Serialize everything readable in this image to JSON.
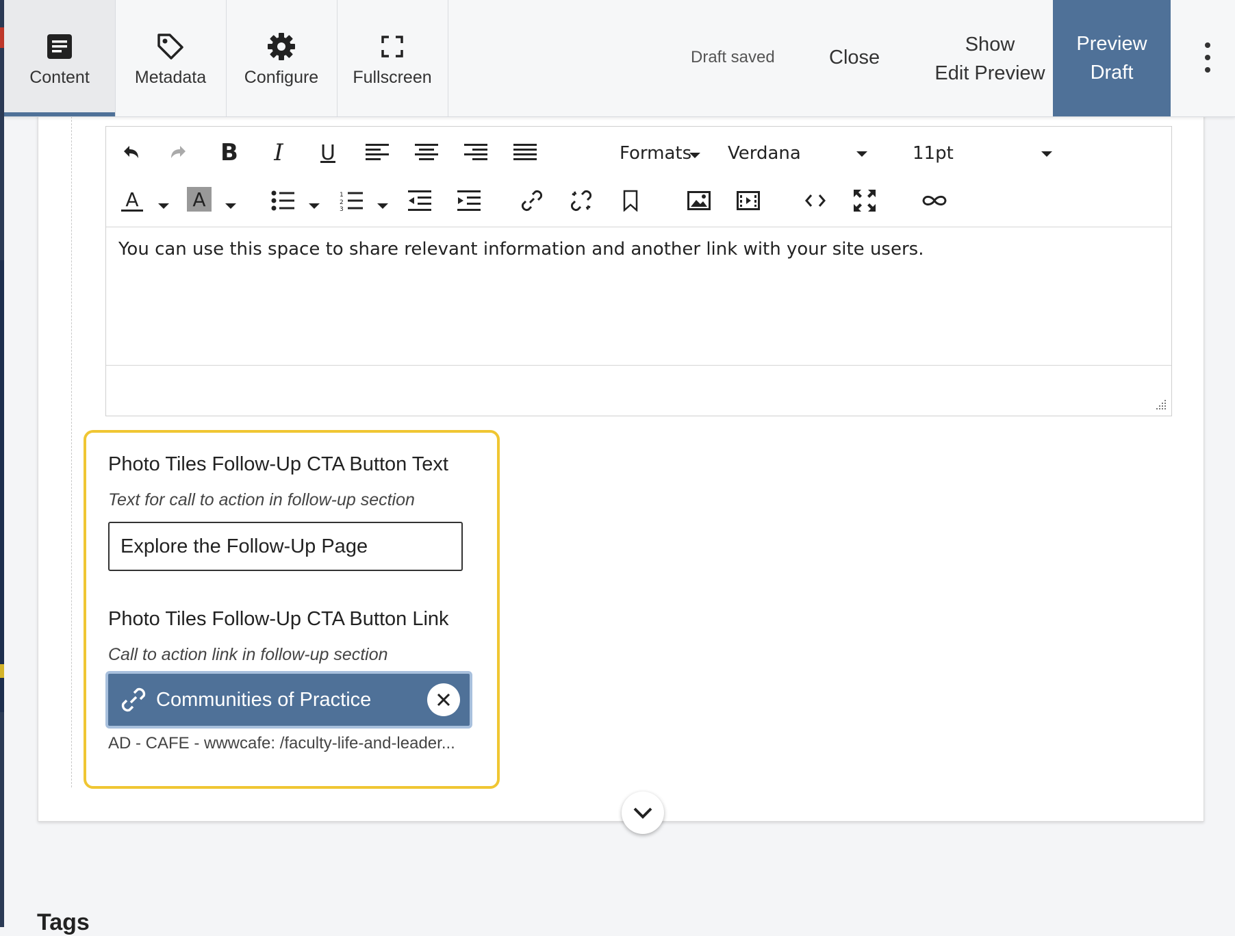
{
  "tabs": [
    {
      "label": "Content",
      "icon": "content-icon",
      "active": true
    },
    {
      "label": "Metadata",
      "icon": "tag-icon"
    },
    {
      "label": "Configure",
      "icon": "gear-icon"
    },
    {
      "label": "Fullscreen",
      "icon": "fullscreen-icon"
    }
  ],
  "header": {
    "status": "Draft saved",
    "close_label": "Close",
    "show_edit_preview_line1": "Show",
    "show_edit_preview_line2": "Edit Preview",
    "preview_draft_line1": "Preview",
    "preview_draft_line2": "Draft",
    "accent_color": "#4f7198"
  },
  "editor": {
    "formats_label": "Formats",
    "font_family": "Verdana",
    "font_size": "11pt",
    "body_text": "You can use this space to share relevant information and another link with your site users."
  },
  "fields": {
    "cta_text_label": "Photo Tiles Follow-Up CTA Button Text",
    "cta_text_help": "Text for call to action in follow-up section",
    "cta_text_value": "Explore the Follow-Up Page",
    "cta_link_label": "Photo Tiles Follow-Up CTA Button Link",
    "cta_link_help": "Call to action link in follow-up section",
    "cta_link_name": "Communities of Practice",
    "cta_link_path": "AD - CAFE - wwwcafe: /faculty-life-and-leader...",
    "highlight_color": "#f0c633"
  },
  "tags_heading": "Tags"
}
